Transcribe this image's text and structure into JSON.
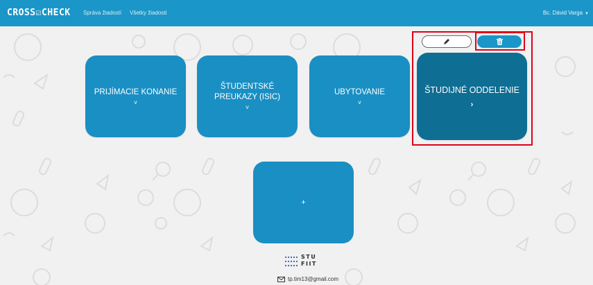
{
  "navbar": {
    "brand": "CROSS☑CHECK",
    "links": [
      "Správa žiadostí",
      "Všetky žiadosti"
    ],
    "user": "Bc. Dávid Varga"
  },
  "tiles": [
    {
      "label": "PRIJÍMACIE KONANIE",
      "chevron": "˅"
    },
    {
      "label": "ŠTUDENTSKÉ PREUKAZY (ISIC)",
      "chevron": "˅"
    },
    {
      "label": "UBYTOVANIE",
      "chevron": "˅"
    },
    {
      "label": "ŠTUDIJNÉ ODDELENIE",
      "chevron": "›"
    }
  ],
  "actions": {
    "edit_icon": "pencil-icon",
    "delete_icon": "trash-icon"
  },
  "add_tile": {
    "label": "+"
  },
  "footer": {
    "logo_line1": "STU",
    "logo_line2": "FIIT",
    "email": "tp.tim13@gmail.com"
  },
  "colors": {
    "navbar": "#1b96c8",
    "tile": "#1a8fc3",
    "tile_active": "#0e6e93",
    "highlight": "#e0001a",
    "background": "#f1f1f1"
  }
}
